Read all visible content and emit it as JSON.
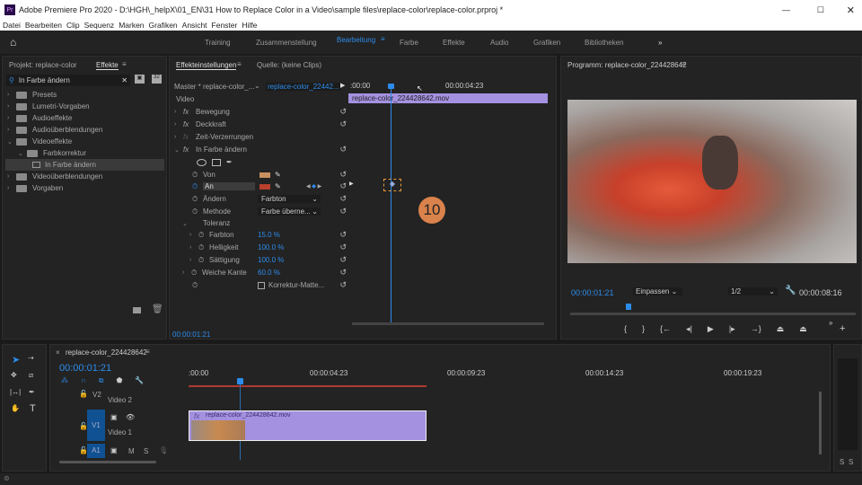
{
  "app": {
    "title": "Adobe Premiere Pro 2020 - D:\\HGH\\_helpX\\01_EN\\31 How to Replace Color in a Video\\sample files\\replace-color\\replace-color.prproj *",
    "icon": "Pr"
  },
  "menu": [
    "Datei",
    "Bearbeiten",
    "Clip",
    "Sequenz",
    "Marken",
    "Grafiken",
    "Ansicht",
    "Fenster",
    "Hilfe"
  ],
  "workspaces": [
    "Training",
    "Zusammenstellung",
    "Bearbeitung",
    "Farbe",
    "Effekte",
    "Audio",
    "Grafiken",
    "Bibliotheken"
  ],
  "active_workspace": "Bearbeitung",
  "left_panel": {
    "tabs": [
      "Projekt: replace-color",
      "Effekte"
    ],
    "search_value": "In Farbe ändern",
    "items": [
      {
        "label": "Presets",
        "level": 0,
        "open": false
      },
      {
        "label": "Lumetri-Vorgaben",
        "level": 0,
        "open": false
      },
      {
        "label": "Audioeffekte",
        "level": 0,
        "open": false
      },
      {
        "label": "Audioüberblendungen",
        "level": 0,
        "open": false
      },
      {
        "label": "Videoeffekte",
        "level": 0,
        "open": true
      },
      {
        "label": "Farbkorrektur",
        "level": 1,
        "open": true
      },
      {
        "label": "In Farbe ändern",
        "level": 2,
        "selected": true
      },
      {
        "label": "Videoüberblendungen",
        "level": 0,
        "open": false
      },
      {
        "label": "Vorgaben",
        "level": 0,
        "open": false
      }
    ]
  },
  "effect_controls": {
    "tabs": [
      "Effekteinstellungen",
      "Quelle: (keine Clips)"
    ],
    "master": "Master * replace-color_...",
    "clip": "replace-color_22442...",
    "section": "Video",
    "time_start": ":00:00",
    "time_mark": "00:00:04:23",
    "clip_bar": "replace-color_224428642.mov",
    "effects": [
      "Bewegung",
      "Deckkraft",
      "Zeit-Verzerrungen",
      "In Farbe ändern"
    ],
    "params": {
      "von": "Von",
      "an": "An",
      "aendern": "Ändern",
      "aendern_value": "Farbton",
      "methode": "Methode",
      "methode_value": "Farbe überne...",
      "toleranz": "Toleranz",
      "farbton": "Farbton",
      "farbton_value": "15.0 %",
      "helligkeit": "Helligkeit",
      "helligkeit_value": "100.0 %",
      "saettigung": "Sättigung",
      "saettigung_value": "100.0 %",
      "weiche": "Weiche Kante",
      "weiche_value": "60.0 %",
      "matte": "Korrektur-Matte..."
    },
    "timecode": "00:00:01:21",
    "step_badge": "10",
    "colors": {
      "von": "#c89060",
      "an": "#b8402e"
    }
  },
  "program": {
    "title": "Programm: replace-color_224428642",
    "timecode": "00:00:01:21",
    "fit": "Einpassen",
    "quality": "1/2",
    "duration": "00:00:08:16"
  },
  "timeline": {
    "title": "replace-color_224428642",
    "timecode": "00:00:01:21",
    "ticks": [
      ":00:00",
      "00:00:04:23",
      "00:00:09:23",
      "00:00:14:23",
      "00:00:19:23"
    ],
    "tracks": {
      "v2": "V2",
      "v2_name": "Video 2",
      "v1": "V1",
      "v1_name": "Video 1",
      "a1": "A1",
      "m": "M",
      "s": "S"
    },
    "clip": "replace-color_224428642.mov",
    "fx": "fx"
  },
  "meters": {
    "s1": "S",
    "s2": "S"
  },
  "accent": "#2d8ceb",
  "clip_color": "#a491e0"
}
